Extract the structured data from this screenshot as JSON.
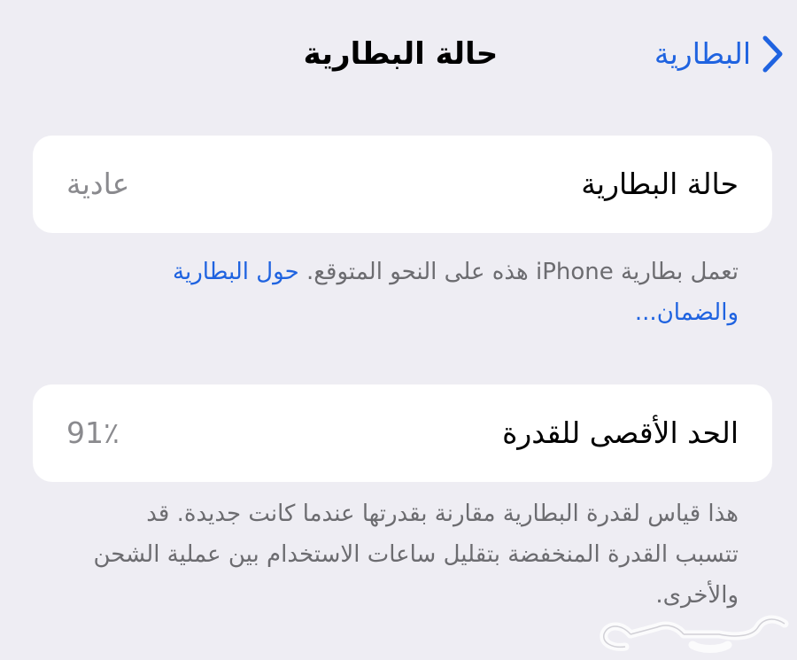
{
  "nav": {
    "back_label": "البطارية",
    "title": "حالة البطارية"
  },
  "health_card": {
    "label": "حالة البطارية",
    "value": "عادية"
  },
  "health_note": {
    "text": "تعمل بطارية iPhone هذه على النحو المتوقع. ",
    "link": "حول البطارية والضمان..."
  },
  "capacity_card": {
    "label": "الحد الأقصى للقدرة",
    "value": "91٪"
  },
  "capacity_note": {
    "text": "هذا قياس لقدرة البطارية مقارنة بقدرتها عندما كانت جديدة. قد تتسبب القدرة المنخفضة بتقليل ساعات الاستخدام بين عملية الشحن والأخرى."
  },
  "watermark": {
    "text": "حراج"
  },
  "colors": {
    "background": "#eeedf3",
    "card": "#ffffff",
    "link": "#1f63e0",
    "secondary_text": "#8a8a8e"
  }
}
